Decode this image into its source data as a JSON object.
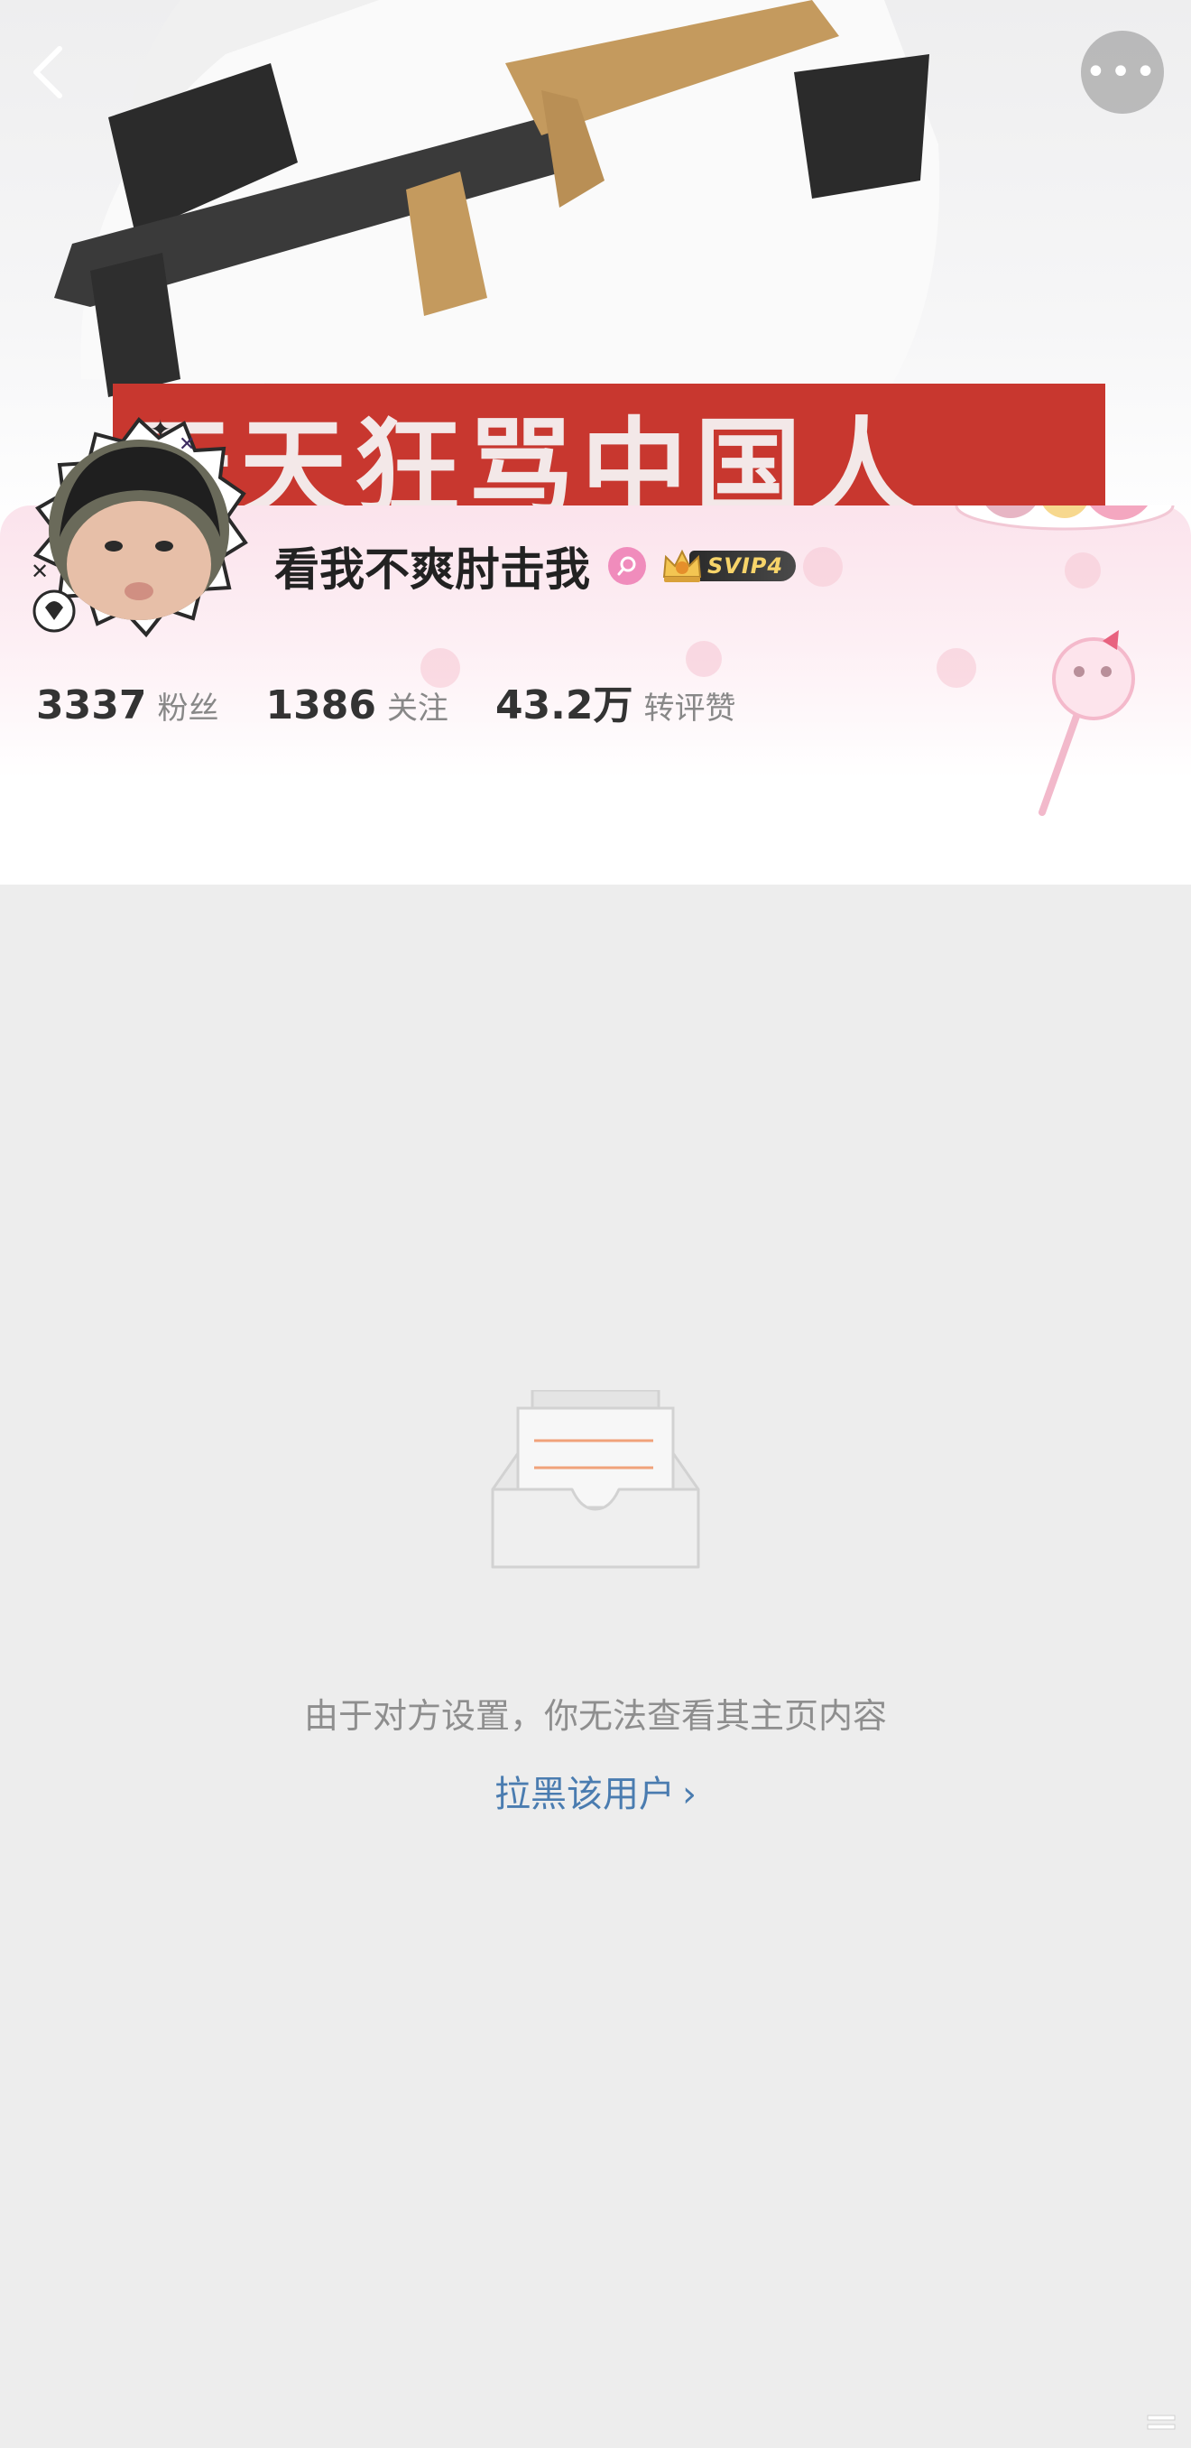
{
  "header": {
    "back_icon": "chevron-left-icon",
    "more_icon": "more-dots-icon",
    "more_label": "•••",
    "cover_banner_text": "天天狂骂中国人"
  },
  "profile": {
    "name": "看我不爽肘击我",
    "gender_icon": "female-icon",
    "vip_label": "SVIP4",
    "stats": [
      {
        "value": "3337",
        "label": "粉丝"
      },
      {
        "value": "1386",
        "label": "关注"
      },
      {
        "value": "43.2万",
        "label": "转评赞"
      }
    ]
  },
  "empty_state": {
    "icon": "empty-inbox-icon",
    "message": "由于对方设置，你无法查看其主页内容",
    "action_label": "拉黑该用户",
    "action_chevron": "›"
  },
  "colors": {
    "link": "#4a7cb0",
    "card_pink": "#fbe3ec",
    "background": "#ededed",
    "accent_orange": "#f0a27a"
  }
}
